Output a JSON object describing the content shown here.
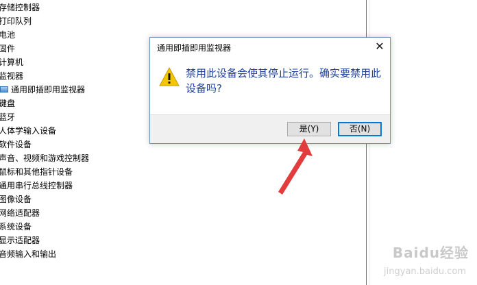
{
  "tree": {
    "items": [
      {
        "label": "存储控制器"
      },
      {
        "label": "打印队列"
      },
      {
        "label": "电池"
      },
      {
        "label": "固件"
      },
      {
        "label": "计算机"
      },
      {
        "label": "监视器"
      },
      {
        "label": "通用即插即用监视器",
        "child": true
      },
      {
        "label": "键盘"
      },
      {
        "label": "蓝牙"
      },
      {
        "label": "人体学输入设备"
      },
      {
        "label": "软件设备"
      },
      {
        "label": "声音、视频和游戏控制器"
      },
      {
        "label": "鼠标和其他指针设备"
      },
      {
        "label": "通用串行总线控制器"
      },
      {
        "label": "图像设备"
      },
      {
        "label": "网络适配器"
      },
      {
        "label": "系统设备"
      },
      {
        "label": "显示适配器"
      },
      {
        "label": "音频输入和输出"
      }
    ]
  },
  "dialog": {
    "title": "通用即插即用监视器",
    "close_symbol": "✕",
    "message": "禁用此设备会使其停止运行。确实要禁用此设备吗?",
    "yes_label": "是(Y)",
    "no_label": "否(N)"
  },
  "watermark": {
    "brand": "Baidu经验",
    "sub": "jingyan.baidu.com"
  },
  "colors": {
    "message": "#1e3f9a",
    "arrow": "#e23c3c",
    "focus": "#0078d7"
  }
}
